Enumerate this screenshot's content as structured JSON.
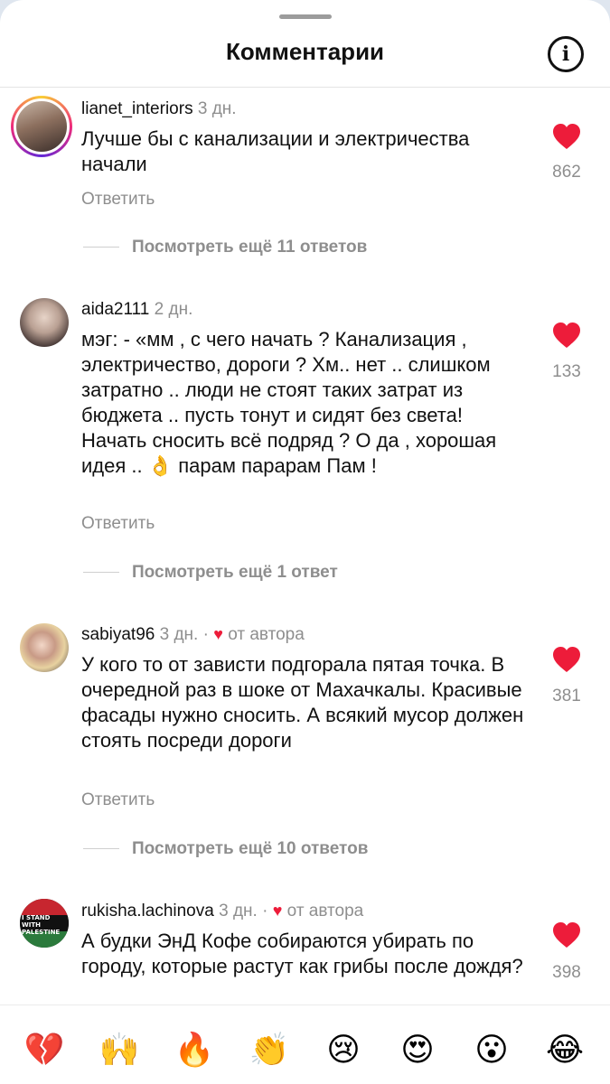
{
  "header": {
    "title": "Комментарии",
    "info_icon": "info-icon"
  },
  "comments": [
    {
      "username": "lianet_interiors",
      "time": "3 дн.",
      "author_liked": "",
      "text": "Лучше бы с канализации и электричества начали",
      "reply": "Ответить",
      "likes": "862",
      "view_more": "Посмотреть ещё 11 ответов"
    },
    {
      "username": "aida2111",
      "time": "2 дн.",
      "author_liked": "",
      "text": "мэг: - «мм , с чего  начать ? Канализация , электричество, дороги ? Хм.. нет .. слишком затратно .. люди не стоят таких затрат из бюджета .. пусть тонут и сидят без света! Начать сносить всё подряд ? О да , хорошая идея .. 👌 парам парарам Пам !",
      "reply": "Ответить",
      "likes": "133",
      "view_more": "Посмотреть ещё 1 ответ"
    },
    {
      "username": "sabiyat96",
      "time": "3 дн.",
      "author_liked": "от автора",
      "text": "У кого то от зависти подгорала пятая точка. В очередной раз в шоке от Махачкалы. Красивые фасады нужно сносить. А всякий мусор должен стоять посреди дороги",
      "reply": "Ответить",
      "likes": "381",
      "view_more": "Посмотреть ещё 10 ответов"
    },
    {
      "username": "rukisha.lachinova",
      "time": "3 дн.",
      "author_liked": "от автора",
      "text": "А будки ЭнД Кофе собираются убирать по городу, которые растут как грибы после дождя?",
      "reply": "",
      "likes": "398",
      "view_more": ""
    }
  ],
  "avatar4_text": "I STAND WITH PALESTINE",
  "reactions": [
    "💔",
    "🙌",
    "🔥",
    "👏",
    "😢",
    "😍",
    "😮",
    "😂"
  ],
  "colors": {
    "heart": "#ed1c3a",
    "muted": "#8e8e8e",
    "text": "#111111"
  }
}
